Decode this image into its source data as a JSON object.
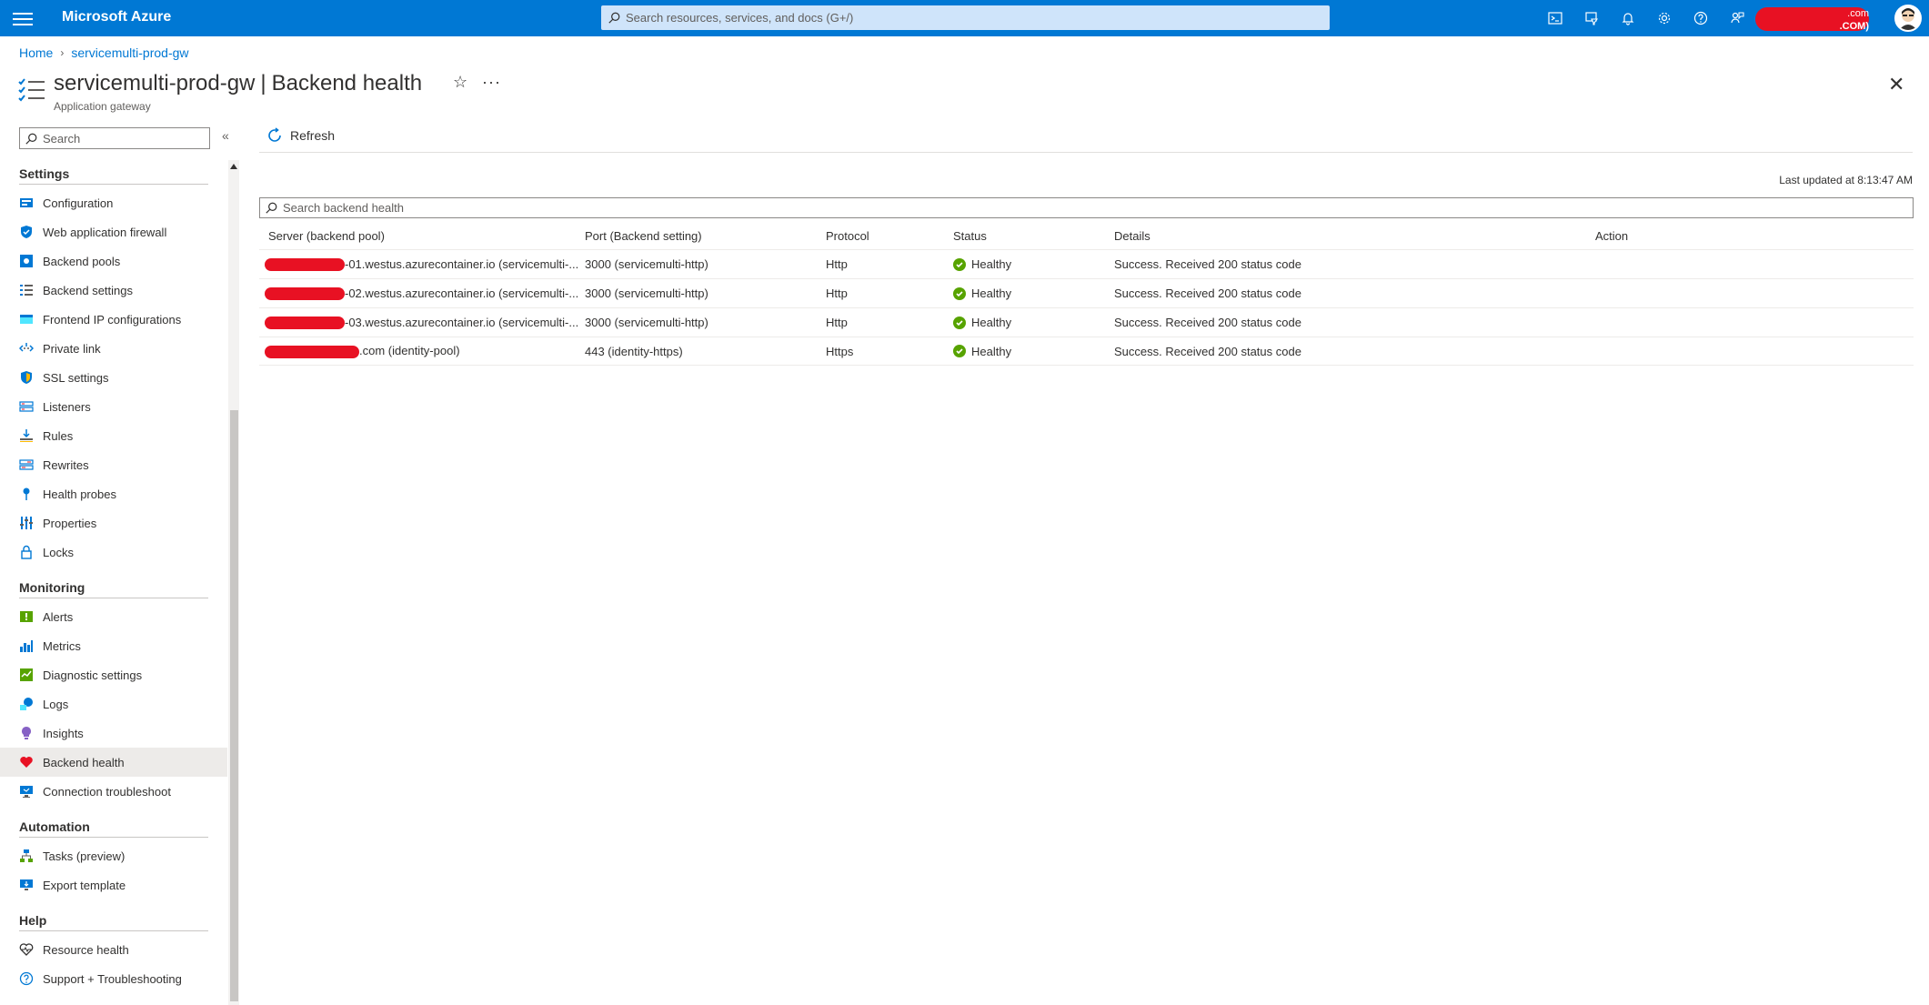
{
  "topbar": {
    "brand": "Microsoft Azure",
    "search_placeholder": "Search resources, services, and docs (G+/)",
    "account_line1": ".com",
    "account_line2": ".COM)",
    "icons": [
      "cloud-shell-icon",
      "directory-filter-icon",
      "notifications-icon",
      "settings-icon",
      "help-icon",
      "feedback-icon"
    ]
  },
  "breadcrumb": {
    "home": "Home",
    "current": "servicemulti-prod-gw"
  },
  "header": {
    "resource_name": "servicemulti-prod-gw",
    "separator": "|",
    "blade_name": "Backend health",
    "subtitle": "Application gateway"
  },
  "sidebar": {
    "search_placeholder": "Search",
    "sections": [
      {
        "label": "Settings",
        "items": [
          {
            "label": "Configuration",
            "icon": "configuration-icon"
          },
          {
            "label": "Web application firewall",
            "icon": "waf-shield-icon"
          },
          {
            "label": "Backend pools",
            "icon": "backend-pools-icon"
          },
          {
            "label": "Backend settings",
            "icon": "backend-settings-icon"
          },
          {
            "label": "Frontend IP configurations",
            "icon": "frontend-ip-icon"
          },
          {
            "label": "Private link",
            "icon": "private-link-icon"
          },
          {
            "label": "SSL settings",
            "icon": "ssl-shield-icon"
          },
          {
            "label": "Listeners",
            "icon": "listeners-icon"
          },
          {
            "label": "Rules",
            "icon": "rules-icon"
          },
          {
            "label": "Rewrites",
            "icon": "rewrites-icon"
          },
          {
            "label": "Health probes",
            "icon": "health-probes-icon"
          },
          {
            "label": "Properties",
            "icon": "properties-icon"
          },
          {
            "label": "Locks",
            "icon": "lock-icon"
          }
        ]
      },
      {
        "label": "Monitoring",
        "items": [
          {
            "label": "Alerts",
            "icon": "alerts-icon"
          },
          {
            "label": "Metrics",
            "icon": "metrics-icon"
          },
          {
            "label": "Diagnostic settings",
            "icon": "diagnostic-settings-icon"
          },
          {
            "label": "Logs",
            "icon": "logs-icon"
          },
          {
            "label": "Insights",
            "icon": "insights-icon"
          },
          {
            "label": "Backend health",
            "icon": "heart-icon",
            "active": true
          },
          {
            "label": "Connection troubleshoot",
            "icon": "connection-troubleshoot-icon"
          }
        ]
      },
      {
        "label": "Automation",
        "items": [
          {
            "label": "Tasks (preview)",
            "icon": "tasks-icon"
          },
          {
            "label": "Export template",
            "icon": "export-template-icon"
          }
        ]
      },
      {
        "label": "Help",
        "items": [
          {
            "label": "Resource health",
            "icon": "resource-health-icon"
          },
          {
            "label": "Support + Troubleshooting",
            "icon": "support-icon"
          }
        ]
      }
    ]
  },
  "main": {
    "refresh_label": "Refresh",
    "last_updated": "Last updated at 8:13:47 AM",
    "table_search_placeholder": "Search backend health",
    "columns": [
      "Server (backend pool)",
      "Port (Backend setting)",
      "Protocol",
      "Status",
      "Details",
      "Action"
    ],
    "rows": [
      {
        "server": "-01.westus.azurecontainer.io (servicemulti-...",
        "port": "3000 (servicemulti-http)",
        "protocol": "Http",
        "status": "Healthy",
        "details": "Success. Received 200 status code"
      },
      {
        "server": "-02.westus.azurecontainer.io (servicemulti-...",
        "port": "3000 (servicemulti-http)",
        "protocol": "Http",
        "status": "Healthy",
        "details": "Success. Received 200 status code"
      },
      {
        "server": "-03.westus.azurecontainer.io (servicemulti-...",
        "port": "3000 (servicemulti-http)",
        "protocol": "Http",
        "status": "Healthy",
        "details": "Success. Received 200 status code"
      },
      {
        "server": ".com (identity-pool)",
        "port": "443 (identity-https)",
        "protocol": "Https",
        "status": "Healthy",
        "details": "Success. Received 200 status code"
      }
    ]
  },
  "colors": {
    "brand_blue": "#0078d4",
    "healthy_green": "#57a300",
    "redaction_red": "#e81123"
  }
}
